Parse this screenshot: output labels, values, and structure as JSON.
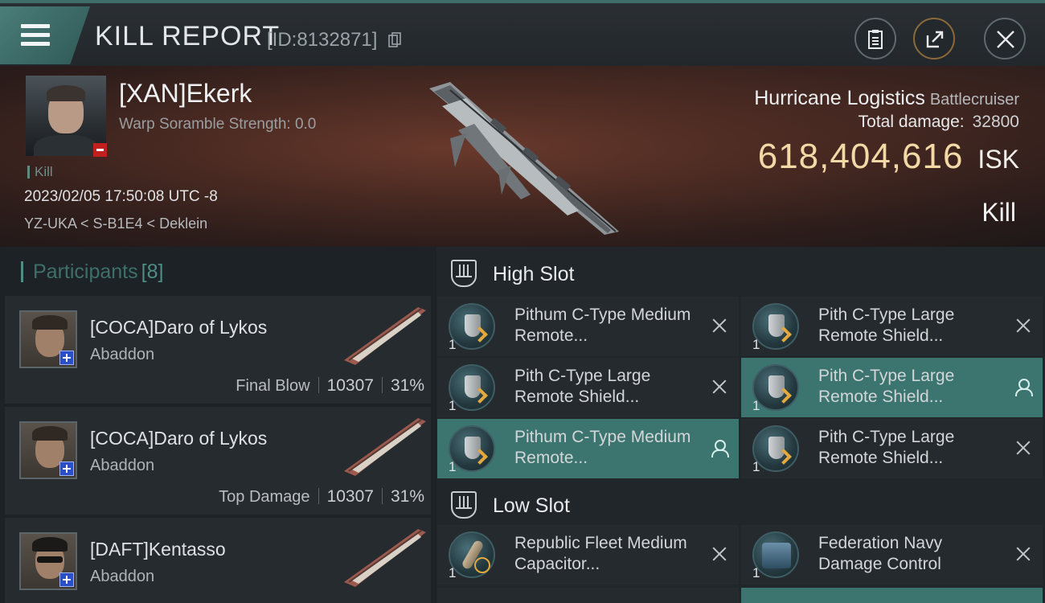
{
  "header": {
    "title": "KILL REPORT",
    "report_id": "[ID:8132871]"
  },
  "victim": {
    "name": "[XAN]Ekerk",
    "warp_scramble": "Warp Soramble Strength: 0.0",
    "kill_tag": "Kill",
    "datetime": "2023/02/05 17:50:08 UTC -8",
    "location": "YZ-UKA < S-B1E4 < Deklein",
    "ship_name": "Hurricane Logistics",
    "ship_class": "Battlecruiser",
    "total_damage_label": "Total damage:",
    "total_damage": "32800",
    "isk_value": "618,404,616",
    "isk_unit": "ISK",
    "result": "Kill"
  },
  "participants": {
    "title": "Participants",
    "count": "[8]",
    "items": [
      {
        "name": "[COCA]Daro of Lykos",
        "ship": "Abaddon",
        "role": "Final Blow",
        "damage": "10307",
        "percent": "31%"
      },
      {
        "name": "[COCA]Daro of Lykos",
        "ship": "Abaddon",
        "role": "Top Damage",
        "damage": "10307",
        "percent": "31%"
      },
      {
        "name": "[DAFT]Kentasso",
        "ship": "Abaddon"
      }
    ]
  },
  "slots": {
    "high_label": "High Slot",
    "low_label": "Low Slot",
    "high": [
      {
        "name": "Pithum C-Type Medium Remote...",
        "qty": "1"
      },
      {
        "name": "Pith C-Type Large Remote Shield...",
        "qty": "1"
      },
      {
        "name": "Pith C-Type Large Remote Shield...",
        "qty": "1"
      },
      {
        "name": "Pith C-Type Large Remote Shield...",
        "qty": "1"
      },
      {
        "name": "Pithum C-Type Medium Remote...",
        "qty": "1"
      },
      {
        "name": "Pith C-Type Large Remote Shield...",
        "qty": "1"
      }
    ],
    "low": [
      {
        "name": "Republic Fleet Medium Capacitor...",
        "qty": "1"
      },
      {
        "name": "Federation Navy Damage Control",
        "qty": "1"
      }
    ]
  },
  "colors": {
    "accent_teal": "#3c7570",
    "isk_gold": "#f3d9a6",
    "victim_badge": "#c21f1f",
    "attacker_badge": "#2a4fc8"
  }
}
